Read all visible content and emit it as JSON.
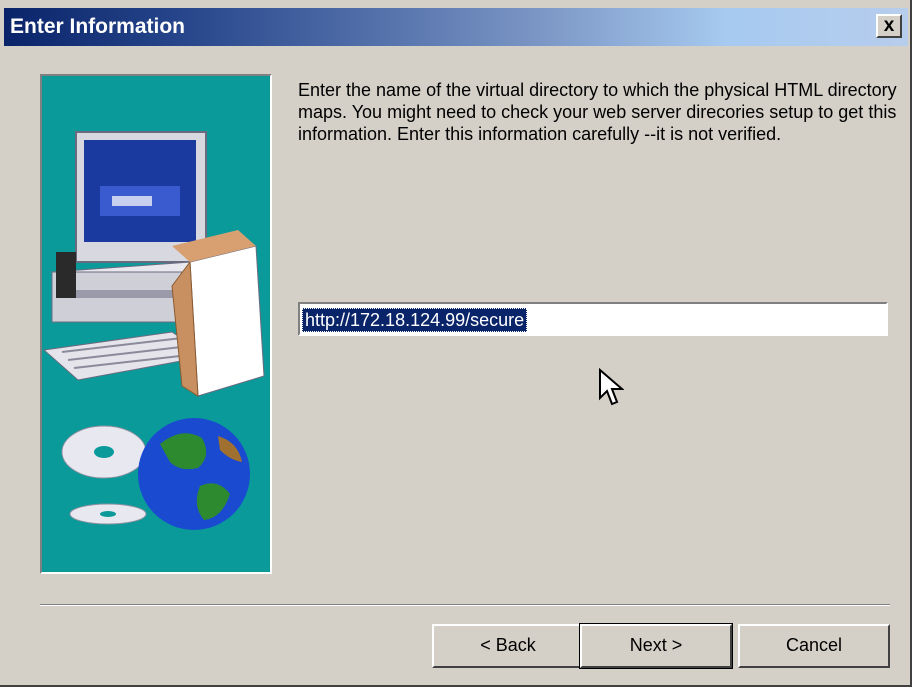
{
  "window": {
    "title": "Enter Information",
    "close_glyph": "x"
  },
  "instruction": "Enter the name of the virtual directory to which the physical HTML directory maps. You might need to check your web server direcories setup to get this information. Enter this information carefully --it is not verified.",
  "url_field": {
    "value": "http://172.18.124.99/secure"
  },
  "buttons": {
    "back": "< Back",
    "next": "Next >",
    "cancel": "Cancel"
  },
  "icons": {
    "close": "close-icon",
    "illustration": "computer-cd-globe-illustration",
    "cursor": "mouse-pointer-icon"
  },
  "colors": {
    "title_bar_start": "#0a246a",
    "title_bar_end": "#a6caf0",
    "dialog_bg": "#d4d0c8",
    "panel_bg": "#0a9a9a",
    "selection": "#0a246a"
  }
}
